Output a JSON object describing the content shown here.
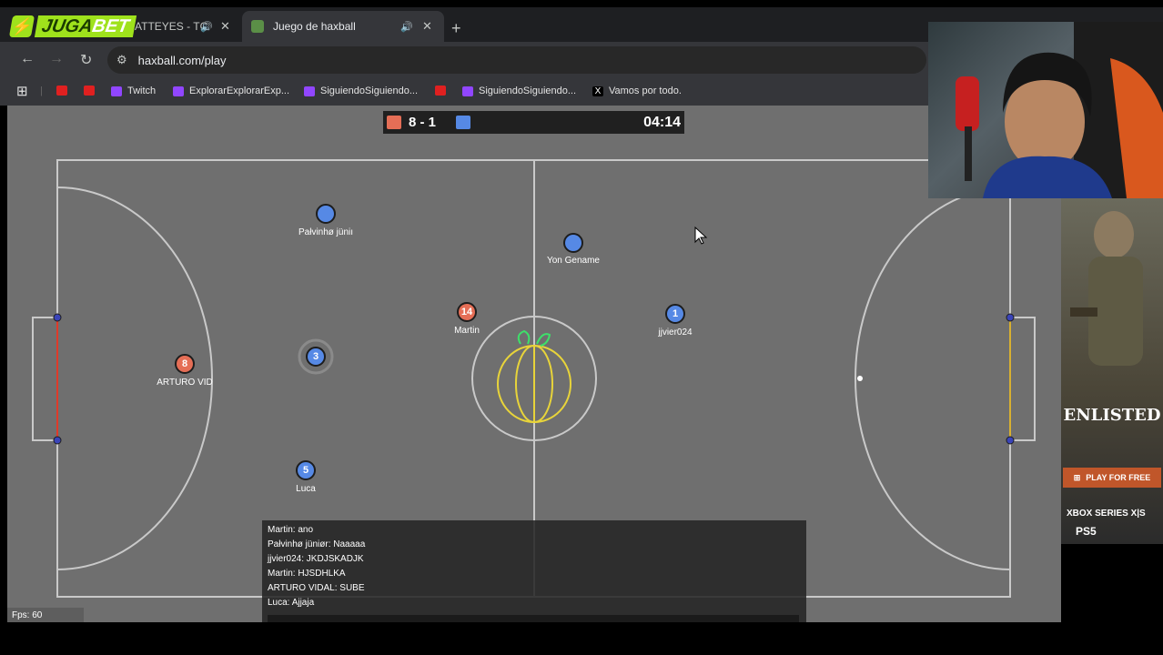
{
  "browser": {
    "tabs": [
      {
        "title": "ATTEYES - TC",
        "active": false
      },
      {
        "title": "Juego de haxball",
        "active": true
      }
    ],
    "url": "haxball.com/play",
    "bookmarks": [
      {
        "label": "",
        "icon": "youtube-icon"
      },
      {
        "label": "",
        "icon": "youtube-icon"
      },
      {
        "label": "Twitch",
        "icon": "twitch-icon"
      },
      {
        "label": "ExplorarExplorarExp...",
        "icon": "twitch-icon"
      },
      {
        "label": "SiguiendoSiguiendo...",
        "icon": "twitch-icon"
      },
      {
        "label": "",
        "icon": "youtube-icon"
      },
      {
        "label": "SiguiendoSiguiendo...",
        "icon": "twitch-icon"
      },
      {
        "label": "Vamos por todo.",
        "icon": "x-icon"
      }
    ]
  },
  "overlay": {
    "logo": "JUGABET"
  },
  "scoreboard": {
    "score": "8 - 1",
    "time": "04:14",
    "red_color": "#e56e56",
    "blue_color": "#5689e5"
  },
  "players": [
    {
      "number": "",
      "name": "Pałvinhø jüniı",
      "team": "blue"
    },
    {
      "number": "",
      "name": "Yon Gename",
      "team": "blue"
    },
    {
      "number": "14",
      "name": "Martin",
      "team": "red"
    },
    {
      "number": "1",
      "name": "jjvier024",
      "team": "blue"
    },
    {
      "number": "8",
      "name": "ARTURO VID",
      "team": "red"
    },
    {
      "number": "3",
      "name": "",
      "team": "blue"
    },
    {
      "number": "5",
      "name": "Luca",
      "team": "blue"
    }
  ],
  "chat": [
    "Martin: ano",
    "Pałvinhø jüniør: Naaaaa",
    "jjvier024: JKDJSKADJK",
    "Martin: HJSDHLKA",
    "ARTURO VIDAL: SUBE",
    "Luca: Ajjaja"
  ],
  "fps": "Fps: 60",
  "ad": {
    "brand": "ENLISTED",
    "cta": "PLAY FOR FREE",
    "platform1": "XBOX SERIES X|S",
    "platform2": "PS5"
  }
}
